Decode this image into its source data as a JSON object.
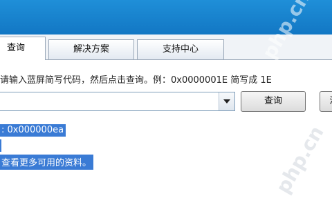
{
  "tabs": [
    {
      "label": "查询"
    },
    {
      "label": "解决方案"
    },
    {
      "label": "支持中心"
    }
  ],
  "hint": "请输入蓝屏简写代码，然后点击查询。例：0x0000001E 简写成 1E",
  "buttons": {
    "query": "查询",
    "cut": "清"
  },
  "results": {
    "line1": ": 0x000000ea",
    "line3": "查看更多可用的资料。"
  },
  "watermark": "php.cn"
}
